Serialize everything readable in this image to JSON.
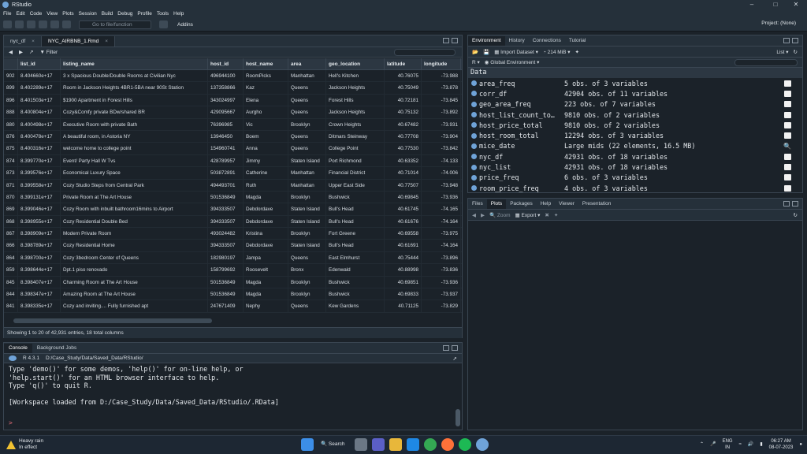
{
  "window": {
    "title": "RStudio",
    "project": "Project: (None)"
  },
  "menu": [
    "File",
    "Edit",
    "Code",
    "View",
    "Plots",
    "Session",
    "Build",
    "Debug",
    "Profile",
    "Tools",
    "Help"
  ],
  "toolbar": {
    "goto_placeholder": "Go to file/function",
    "addins": "Addins"
  },
  "editor": {
    "tabs": [
      {
        "label": "nyc_df"
      },
      {
        "label": "NYC_AIRBNB_1.Rmd"
      }
    ],
    "filter_label": "Filter",
    "columns": [
      "",
      "list_id",
      "listing_name",
      "host_id",
      "host_name",
      "area",
      "geo_location",
      "latitude",
      "longitude"
    ],
    "rows": [
      [
        "902",
        "8.404660e+17",
        "3 x Spacious Double/Double Rooms at Civilian Nyc",
        "496944100",
        "RoomPicks",
        "Manhattan",
        "Hell's Kitchen",
        "40.76075",
        "-73.988"
      ],
      [
        "899",
        "8.402289e+17",
        "Room in Jackson Heights 4BR1-5BA near 90St Station",
        "137358866",
        "Kaz",
        "Queens",
        "Jackson Heights",
        "40.75049",
        "-73.878"
      ],
      [
        "896",
        "8.401503e+17",
        "$1900 Apartment in Forest Hills",
        "343024997",
        "Elena",
        "Queens",
        "Forest Hills",
        "40.72181",
        "-73.845"
      ],
      [
        "888",
        "8.400804e+17",
        "Cozy&Comfy private BDw/shared BR",
        "429095667",
        "Aurgho",
        "Queens",
        "Jackson Heights",
        "40.75132",
        "-73.892"
      ],
      [
        "880",
        "8.400498e+17",
        "Executive Room with private Bath",
        "76396985",
        "Vic",
        "Brooklyn",
        "Crown Heights",
        "40.67482",
        "-73.931"
      ],
      [
        "876",
        "8.400478e+17",
        "A beautiful room, in Astoria NY",
        "13946450",
        "Boem",
        "Queens",
        "Ditmars Steinway",
        "40.77708",
        "-73.904"
      ],
      [
        "875",
        "8.400316e+17",
        "welcome home to college point",
        "154960741",
        "Anna",
        "Queens",
        "College Point",
        "40.77530",
        "-73.842"
      ],
      [
        "874",
        "8.399770e+17",
        "Event/ Party Hall W Tvs",
        "428789957",
        "Jimmy",
        "Staten Island",
        "Port Richmond",
        "40.63352",
        "-74.133"
      ],
      [
        "873",
        "8.399576e+17",
        "Economical Luxury Space",
        "503872891",
        "Catherine",
        "Manhattan",
        "Financial District",
        "40.71014",
        "-74.006"
      ],
      [
        "871",
        "8.399558e+17",
        "Cozy Studio Steps from  Central Park",
        "494493701",
        "Ruth",
        "Manhattan",
        "Upper East Side",
        "40.77507",
        "-73.948"
      ],
      [
        "870",
        "8.399131e+17",
        "Private Room at The Art House",
        "501536849",
        "Magda",
        "Brooklyn",
        "Bushwick",
        "40.69845",
        "-73.936"
      ],
      [
        "869",
        "8.399046e+17",
        "Cozy Room with inbuilt bathroom16mins to Airport",
        "394333507",
        "Debdordave",
        "Staten Island",
        "Bull's Head",
        "40.61745",
        "-74.165"
      ],
      [
        "868",
        "8.398955e+17",
        "Cozy Residential Double Bed",
        "394333507",
        "Debdordave",
        "Staten Island",
        "Bull's Head",
        "40.61676",
        "-74.164"
      ],
      [
        "867",
        "8.398909e+17",
        "Modern Private Room",
        "493024482",
        "Kristina",
        "Brooklyn",
        "Fort Greene",
        "40.69558",
        "-73.975"
      ],
      [
        "866",
        "8.398789e+17",
        "Cozy Residential Home",
        "394333507",
        "Debdordave",
        "Staten Island",
        "Bull's Head",
        "40.61691",
        "-74.164"
      ],
      [
        "864",
        "8.398700e+17",
        "Cozy 3bedroom Center of Queens",
        "182980197",
        "Jampa",
        "Queens",
        "East Elmhurst",
        "40.75444",
        "-73.896"
      ],
      [
        "859",
        "8.398644e+17",
        "Dpt.1 piso  renovado",
        "158799692",
        "Roosevelt",
        "Bronx",
        "Edenwald",
        "40.88998",
        "-73.836"
      ],
      [
        "845",
        "8.398407e+17",
        "Charming Room at The Art House",
        "501536849",
        "Magda",
        "Brooklyn",
        "Bushwick",
        "40.69851",
        "-73.936"
      ],
      [
        "844",
        "8.398347e+17",
        "Amazing Room at The Art House",
        "501536849",
        "Magda",
        "Brooklyn",
        "Bushwick",
        "40.69833",
        "-73.937"
      ],
      [
        "841",
        "8.398335e+17",
        "Cozy and inviting.... Fully furnished apt",
        "247671409",
        "Nephy",
        "Queens",
        "Kew Gardens",
        "40.71125",
        "-73.829"
      ]
    ],
    "status": "Showing 1 to 20 of 42,931 entries, 18 total columns"
  },
  "console": {
    "tabs": [
      "Console",
      "Background Jobs"
    ],
    "r_version": "R 4.3.1",
    "path": "D:/Case_Study/Data/Saved_Data/RStudio/",
    "lines": [
      "Type 'demo()' for some demos, 'help()' for on-line help, or",
      "'help.start()' for an HTML browser interface to help.",
      "Type 'q()' to quit R.",
      "",
      "[Workspace loaded from D:/Case_Study/Data/Saved_Data/RStudio/.RData]"
    ],
    "prompt": ">"
  },
  "environment": {
    "tabs": [
      "Environment",
      "History",
      "Connections",
      "Tutorial"
    ],
    "import_label": "Import Dataset",
    "memory": "214 MiB",
    "list_label": "List",
    "r_label": "R",
    "scope": "Global Environment",
    "section": "Data",
    "items": [
      {
        "name": "area_freq",
        "value": "5 obs. of 3 variables"
      },
      {
        "name": "corr_df",
        "value": "42904 obs. of 11 variables"
      },
      {
        "name": "geo_area_freq",
        "value": "223 obs. of 7 variables"
      },
      {
        "name": "host_list_count_to…",
        "value": "9810 obs. of 2 variables"
      },
      {
        "name": "host_price_total",
        "value": "9810 obs. of 2 variables"
      },
      {
        "name": "host_room_total",
        "value": "12294 obs. of 3 variables"
      },
      {
        "name": "mice_date",
        "value": "Large mids (22 elements,  16.5 MB)"
      },
      {
        "name": "nyc_df",
        "value": "42931 obs. of 18 variables"
      },
      {
        "name": "nyc_list",
        "value": "42931 obs. of 18 variables"
      },
      {
        "name": "price_freq",
        "value": "6 obs. of 3 variables"
      },
      {
        "name": "room_price_freq",
        "value": "4 obs. of 3 variables"
      }
    ]
  },
  "files": {
    "tabs": [
      "Files",
      "Plots",
      "Packages",
      "Help",
      "Viewer",
      "Presentation"
    ],
    "zoom": "Zoom",
    "export": "Export"
  },
  "taskbar": {
    "weather_title": "Heavy rain",
    "weather_sub": "In effect",
    "search": "Search",
    "lang1": "ENG",
    "lang2": "IN",
    "time": "06:27 AM",
    "date": "08-07-2023"
  }
}
